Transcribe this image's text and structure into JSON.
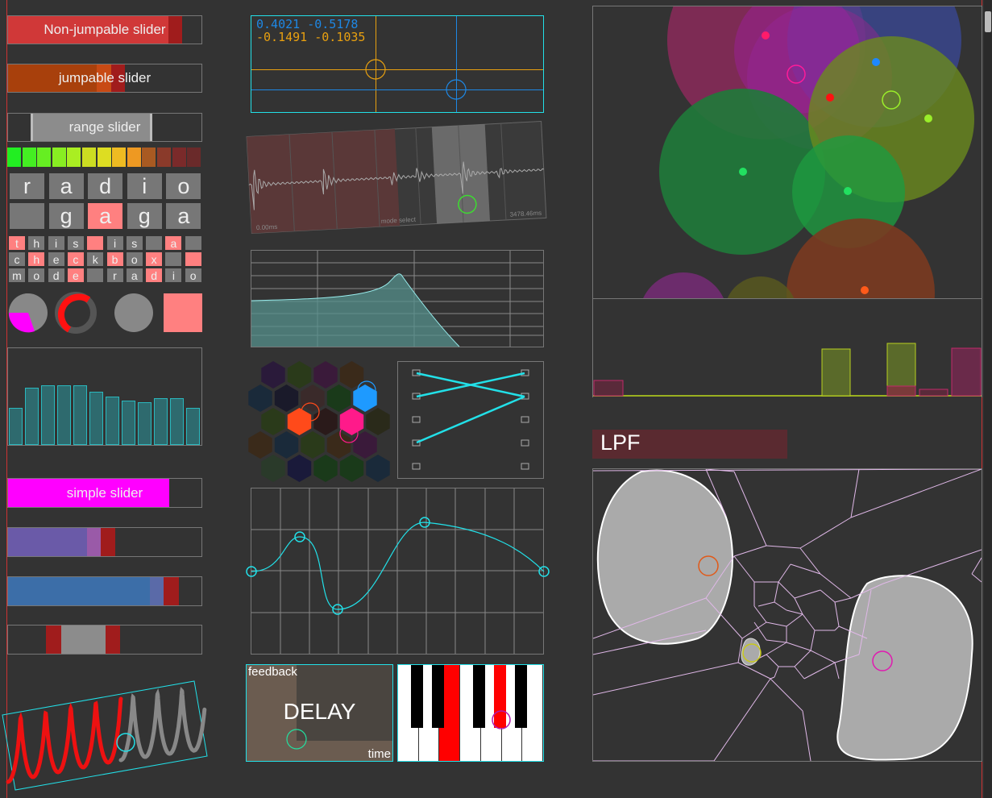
{
  "sliders": {
    "non_jumpable": "Non-jumpable slider",
    "jumpable": "jumpable slider",
    "range": "range slider",
    "simple": "simple slider"
  },
  "radio": {
    "row1": [
      "r",
      "a",
      "d",
      "i",
      "o"
    ],
    "row2": [
      "",
      "g",
      "a",
      "g",
      "a"
    ]
  },
  "checkbox": {
    "row1": [
      "t",
      "h",
      "i",
      "s",
      "",
      "i",
      "s",
      "",
      "a",
      ""
    ],
    "row2": [
      "c",
      "h",
      "e",
      "c",
      "k",
      "b",
      "o",
      "x",
      "",
      ""
    ],
    "row3": [
      "m",
      "o",
      "d",
      "e",
      "",
      "r",
      "a",
      "d",
      "i",
      "o"
    ]
  },
  "xy_pad": {
    "line1": "0.4021 -0.5178",
    "line2": "-0.1491 -0.1035"
  },
  "waveform": {
    "start": "0.00ms",
    "mode": "mode select",
    "end": "3478.46ms"
  },
  "delay_pad": {
    "title": "DELAY",
    "y_label": "feedback",
    "x_label": "time"
  },
  "lpf_label": "LPF",
  "multislider_values": [
    0.38,
    0.59,
    0.62,
    0.62,
    0.62,
    0.55,
    0.5,
    0.46,
    0.44,
    0.48,
    0.48,
    0.38
  ],
  "colors": {
    "accent_cyan": "#22e0e8",
    "magenta": "#ff00ff",
    "red": "#ff1111",
    "pink": "#ff8080"
  }
}
